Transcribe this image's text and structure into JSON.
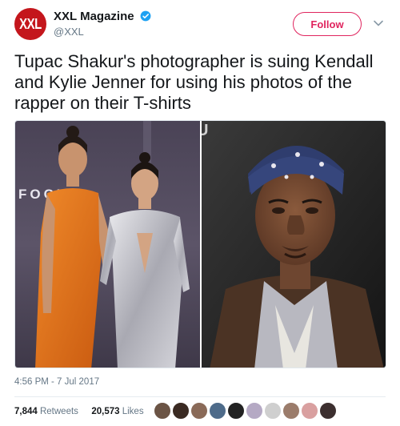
{
  "account": {
    "name": "XXL Magazine",
    "handle": "@XXL",
    "avatar_text": "XXL",
    "brand_color": "#c4161c",
    "verified_icon": "verified-badge-icon"
  },
  "follow_button": {
    "label": "Follow",
    "color": "#e0245e"
  },
  "tweet": {
    "text": "Tupac Shakur's photographer is suing Kendall and Kylie Jenner for using his photos of the rapper on their T-shirts",
    "timestamp": "4:56 PM - 7 Jul 2017"
  },
  "media": {
    "left_backdrop_text": "FOCUS",
    "right_backdrop_text": "U"
  },
  "stats": {
    "retweets_count": "7,844",
    "retweets_label": "Retweets",
    "likes_count": "20,573",
    "likes_label": "Likes"
  },
  "likers": [
    {
      "color": "#6b5445"
    },
    {
      "color": "#3a2a22"
    },
    {
      "color": "#8a6a58"
    },
    {
      "color": "#4e6b8a"
    },
    {
      "color": "#222222"
    },
    {
      "color": "#b5a9c4"
    },
    {
      "color": "#cfcfcf"
    },
    {
      "color": "#9b7c6b"
    },
    {
      "color": "#d9a0a0"
    },
    {
      "color": "#3c2f2f"
    }
  ]
}
